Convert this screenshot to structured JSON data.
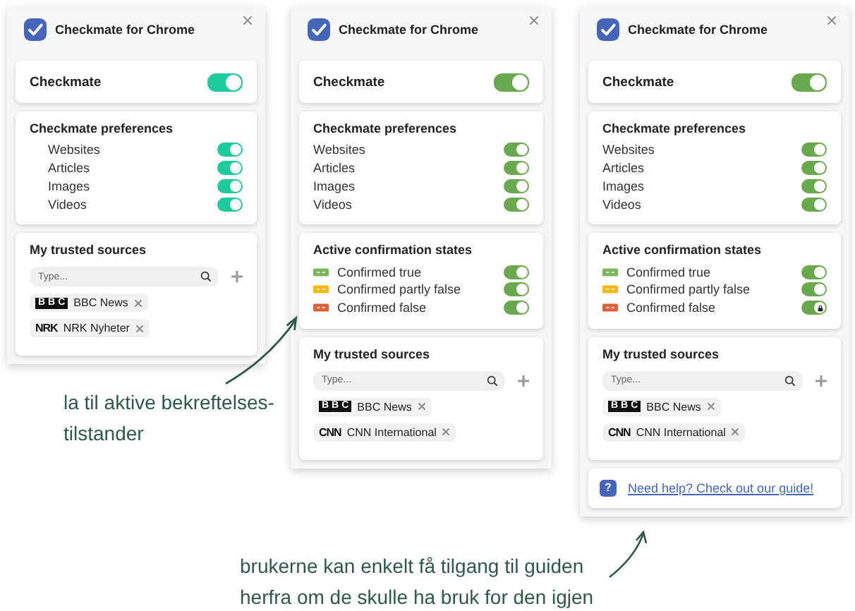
{
  "panels": [
    {
      "title": "Checkmate for Chrome",
      "color": "#1ec99b",
      "master": {
        "label": "Checkmate",
        "on": true
      },
      "sections": [
        {
          "kind": "toggles",
          "title": "Checkmate preferences",
          "indented": true,
          "items": [
            {
              "label": "Websites",
              "on": true
            },
            {
              "label": "Articles",
              "on": true
            },
            {
              "label": "Images",
              "on": true
            },
            {
              "label": "Videos",
              "on": true
            }
          ]
        },
        {
          "kind": "sources",
          "title": "My trusted sources",
          "placeholder": "Type...",
          "sources": [
            {
              "logo": "BBC",
              "name": "BBC News",
              "kind": "blocks"
            },
            {
              "logo": "NRK",
              "name": "NRK Nyheter",
              "kind": "wordmark"
            }
          ]
        }
      ]
    },
    {
      "title": "Checkmate for Chrome",
      "color": "#6aa84f",
      "master": {
        "label": "Checkmate",
        "on": true
      },
      "sections": [
        {
          "kind": "toggles",
          "title": "Checkmate preferences",
          "indented": false,
          "items": [
            {
              "label": "Websites",
              "on": true
            },
            {
              "label": "Articles",
              "on": true
            },
            {
              "label": "Images",
              "on": true
            },
            {
              "label": "Videos",
              "on": true
            }
          ]
        },
        {
          "kind": "toggles",
          "title": "Active confirmation states",
          "indented": false,
          "items": [
            {
              "label": "Confirmed true",
              "on": true,
              "color": "#7ab55c"
            },
            {
              "label": "Confirmed partly false",
              "on": true,
              "color": "#f5b916"
            },
            {
              "label": "Confirmed false",
              "on": true,
              "color": "#e0603a"
            }
          ]
        },
        {
          "kind": "sources",
          "title": "My trusted sources",
          "placeholder": "Type...",
          "sources": [
            {
              "logo": "BBC",
              "name": "BBC News",
              "kind": "blocks"
            },
            {
              "logo": "CNN",
              "name": "CNN International",
              "kind": "wordmark"
            }
          ]
        }
      ]
    },
    {
      "title": "Checkmate for Chrome",
      "color": "#6aa84f",
      "master": {
        "label": "Checkmate",
        "on": true
      },
      "sections": [
        {
          "kind": "toggles",
          "title": "Checkmate preferences",
          "indented": false,
          "items": [
            {
              "label": "Websites",
              "on": true
            },
            {
              "label": "Articles",
              "on": true
            },
            {
              "label": "Images",
              "on": true
            },
            {
              "label": "Videos",
              "on": true
            }
          ]
        },
        {
          "kind": "toggles",
          "title": "Active confirmation states",
          "indented": false,
          "items": [
            {
              "label": "Confirmed true",
              "on": true,
              "color": "#7ab55c"
            },
            {
              "label": "Confirmed partly false",
              "on": true,
              "color": "#f5b916"
            },
            {
              "label": "Confirmed false",
              "on": true,
              "locked": true,
              "color": "#e0603a"
            }
          ]
        },
        {
          "kind": "sources",
          "title": "My trusted sources",
          "placeholder": "Type...",
          "sources": [
            {
              "logo": "BBC",
              "name": "BBC News",
              "kind": "blocks"
            },
            {
              "logo": "CNN",
              "name": "CNN International",
              "kind": "wordmark"
            }
          ]
        },
        {
          "kind": "help",
          "icon": "?",
          "link": "Need help? Check out our guide!"
        }
      ]
    }
  ],
  "annotations": [
    "la til aktive bekreftelses-tilstander",
    "brukerne kan enkelt få tilgang til guiden herfra om de skulle ha bruk for den igjen"
  ]
}
